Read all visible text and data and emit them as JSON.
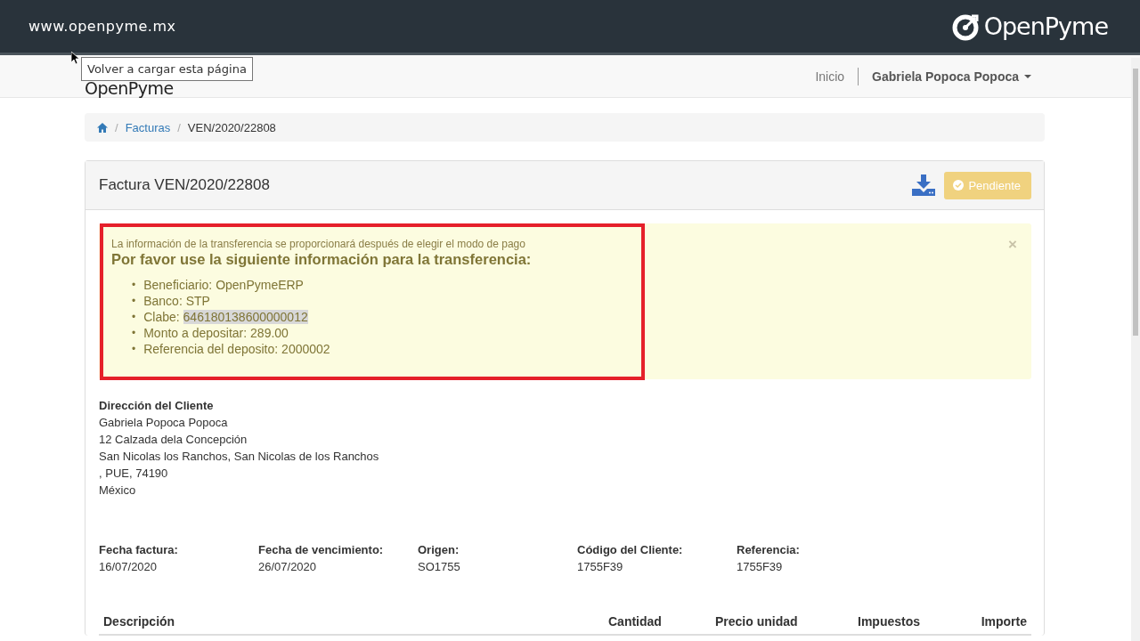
{
  "banner": {
    "url": "www.openpyme.mx",
    "logo": "OpenPyme"
  },
  "navbar": {
    "brand": "OpenPyme",
    "links": [
      {
        "label": "Inicio"
      },
      {
        "label": "Gabriela Popoca Popoca",
        "dropdown": true
      }
    ]
  },
  "tooltip": "Volver a cargar esta página",
  "breadcrumb": [
    {
      "label": "Facturas",
      "kind": "link",
      "separator": "/"
    },
    {
      "label": "VEN/2020/22808",
      "kind": "current",
      "separator": "/"
    }
  ],
  "panel": {
    "title": "Factura VEN/2020/22808",
    "status": "Pendiente",
    "alert": {
      "close": "×",
      "bullet": "•",
      "note": "La información de la transferencia se proporcionará después de elegir el modo de pago",
      "heading": "Por favor use la siguiente información para la transferencia:",
      "highlighted": true,
      "items": [
        {
          "label": "Beneficiario:",
          "value": "OpenPymeERP",
          "selected": false
        },
        {
          "label": "Banco:",
          "value": "STP",
          "selected": false
        },
        {
          "label": "Clabe:",
          "value": "646180138600000012",
          "selected": true
        },
        {
          "label": "Monto a depositar:",
          "value": "289.00",
          "selected": false
        },
        {
          "label": "Referencia del deposito:",
          "value": "2000002",
          "selected": false
        }
      ]
    },
    "address": {
      "title": "Dirección del Cliente",
      "lines": [
        "Gabriela Popoca Popoca",
        "12 Calzada dela Concepción",
        "San Nicolas los Ranchos, San Nicolas de los Ranchos",
        ", PUE, 74190",
        "México"
      ]
    },
    "fields": [
      {
        "label": "Fecha factura:",
        "value": "16/07/2020"
      },
      {
        "label": "Fecha de vencimiento:",
        "value": "26/07/2020"
      },
      {
        "label": "Origen:",
        "value": "SO1755"
      },
      {
        "label": "Código del Cliente:",
        "value": "1755F39"
      },
      {
        "label": "Referencia:",
        "value": "1755F39"
      }
    ],
    "table": {
      "columns": [
        "Descripción",
        "Cantidad",
        "Precio unidad",
        "Impuestos",
        "Importe"
      ]
    }
  }
}
